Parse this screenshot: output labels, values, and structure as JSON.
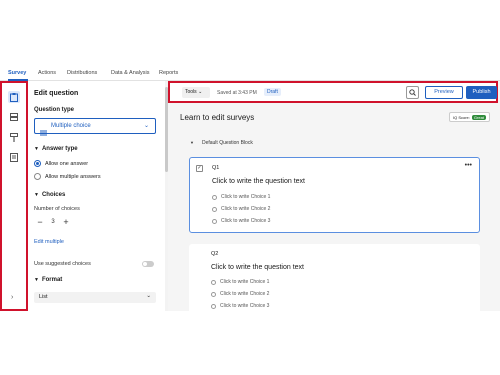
{
  "topnav": {
    "tabs": [
      "Survey",
      "Actions",
      "Distributions",
      "Data & Analysis",
      "Reports"
    ]
  },
  "rail": {
    "icons": [
      "survey-icon",
      "flow-icon",
      "style-icon",
      "options-icon"
    ],
    "expand": "›"
  },
  "panel": {
    "title": "Edit question",
    "question_type_label": "Question type",
    "question_type_value": "Multiple choice",
    "answer_type_label": "Answer type",
    "answer_options": [
      "Allow one answer",
      "Allow multiple answers"
    ],
    "choices_label": "Choices",
    "num_choices_label": "Number of choices",
    "num_choices_value": "3",
    "edit_multiple": "Edit multiple",
    "suggested": "Use suggested choices",
    "format_label": "Format",
    "format_value": "List"
  },
  "toolbar": {
    "tools": "Tools",
    "saved": "Saved at 3:43 PM",
    "draft": "Draft",
    "preview": "Preview",
    "publish": "Publish"
  },
  "main": {
    "title": "Learn to edit surveys",
    "iq_label": "IQ Score:",
    "iq_value": "Great",
    "block": "Default Question Block",
    "questions": [
      {
        "num": "Q1",
        "text": "Click to write the question text",
        "choices": [
          "Click to write Choice 1",
          "Click to write Choice 2",
          "Click to write Choice 3"
        ]
      },
      {
        "num": "Q2",
        "text": "Click to write the question text",
        "choices": [
          "Click to write Choice 1",
          "Click to write Choice 2",
          "Click to write Choice 3"
        ]
      }
    ]
  },
  "colors": {
    "accent": "#1f5fbf",
    "highlight": "#d0122c"
  }
}
